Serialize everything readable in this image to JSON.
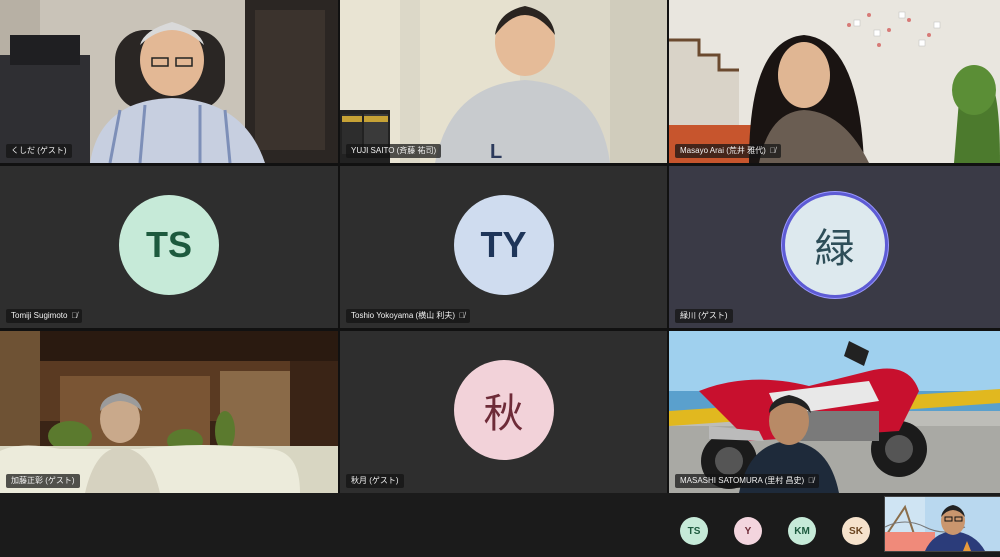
{
  "participants": [
    {
      "name": "くしだ (ゲスト)",
      "muted": false,
      "type": "video"
    },
    {
      "name": "YUJI SAITO (斉藤 祐司)",
      "muted": false,
      "type": "video"
    },
    {
      "name": "Masayo Arai (荒井 雅代)",
      "muted": true,
      "type": "video"
    },
    {
      "name": "Tomiji Sugimoto",
      "muted": true,
      "type": "avatar",
      "initials": "TS",
      "avatar_bg": "#c6ead8",
      "avatar_fg": "#1d5a3e"
    },
    {
      "name": "Toshio Yokoyama (横山 利夫)",
      "muted": true,
      "type": "avatar",
      "initials": "TY",
      "avatar_bg": "#cfdcef",
      "avatar_fg": "#1e3559"
    },
    {
      "name": "緑川 (ゲスト)",
      "muted": false,
      "type": "avatar",
      "initials": "緑",
      "avatar_bg": "#dde9ee",
      "avatar_fg": "#2e4e58",
      "speaking": true
    },
    {
      "name": "加藤正彰 (ゲスト)",
      "muted": false,
      "type": "video"
    },
    {
      "name": "秋月 (ゲスト)",
      "muted": false,
      "type": "avatar",
      "initials": "秋",
      "avatar_bg": "#f2d2d9",
      "avatar_fg": "#6e2b38"
    },
    {
      "name": "MASASHI SATOMURA (里村 昌史)",
      "muted": true,
      "type": "video"
    }
  ],
  "overflow": [
    {
      "initials": "TS",
      "bg": "#c6ead8",
      "fg": "#1d5a3e"
    },
    {
      "initials": "Y",
      "bg": "#f3d5de",
      "fg": "#6e2b38"
    },
    {
      "initials": "KM",
      "bg": "#c6ead8",
      "fg": "#1d5a3e"
    },
    {
      "initials": "SK",
      "bg": "#f6e2cc",
      "fg": "#6b4520"
    }
  ],
  "icons": {
    "muted": "mic-off-icon"
  }
}
